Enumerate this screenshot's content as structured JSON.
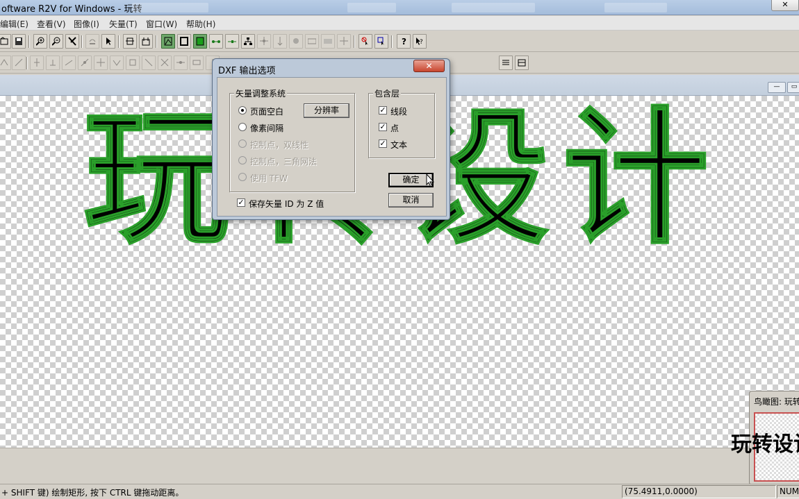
{
  "window": {
    "title": "oftware R2V for Windows - 玩转"
  },
  "menu": {
    "items": [
      "编辑(E)",
      "查看(V)",
      "图像(I)",
      "矢量(T)",
      "窗口(W)",
      "帮助(H)"
    ]
  },
  "canvas": {
    "text": "玩转设计"
  },
  "dialog": {
    "title": "DXF 输出选项",
    "close_label": "✕",
    "vector_group": {
      "label": "矢量调整系统",
      "options": [
        {
          "label": "页面空白",
          "selected": true,
          "enabled": true
        },
        {
          "label": "像素间隔",
          "selected": false,
          "enabled": true
        },
        {
          "label": "控制点，双线性",
          "selected": false,
          "enabled": false
        },
        {
          "label": "控制点，三角网法",
          "selected": false,
          "enabled": false
        },
        {
          "label": "使用 TFW",
          "selected": false,
          "enabled": false
        }
      ],
      "resolution_button": "分辨率"
    },
    "layers_group": {
      "label": "包含层",
      "items": [
        {
          "label": "线段",
          "checked": true
        },
        {
          "label": "点",
          "checked": true
        },
        {
          "label": "文本",
          "checked": true
        }
      ]
    },
    "save_id": {
      "label": "保存矢量 ID 为 Z 值",
      "checked": true
    },
    "ok_label": "确定",
    "cancel_label": "取消"
  },
  "birdseye": {
    "title": "鸟瞰图: 玩转",
    "preview_text": "玩转设计"
  },
  "status": {
    "hint": "+ SHIFT 键) 绘制矩形, 按下 CTRL 键拖动距离。",
    "coords": "(75.4911,0.0000)",
    "num": "NUM"
  },
  "icons": {
    "toolbar1": [
      "open-icon",
      "save-icon",
      "zoom-in-icon",
      "zoom-out-icon",
      "select-vector-icon",
      "undo-icon",
      "pointer-icon",
      "fit-icon",
      "layout-icon",
      "node-edit-icon",
      "frame-icon",
      "fill-icon",
      "line-node-icon",
      "line-end-icon",
      "tree-icon",
      "point-icon",
      "split-icon",
      "circle-icon",
      "abc-outline-icon",
      "abc-icon",
      "cross-icon",
      "delete-select-icon",
      "node-select-icon",
      "help-icon",
      "context-help-icon"
    ],
    "toolbar2": [
      "tool-a-icon",
      "tool-b-icon",
      "tool-c-icon",
      "tool-d-icon",
      "tool-e-icon",
      "tool-f-icon",
      "tool-g-icon",
      "tool-h-icon",
      "tool-i-icon",
      "tool-j-icon",
      "tool-k-icon",
      "tool-l-icon",
      "tool-m-icon",
      "tool-n-icon",
      "layer-list-icon",
      "layer-props-icon"
    ]
  }
}
